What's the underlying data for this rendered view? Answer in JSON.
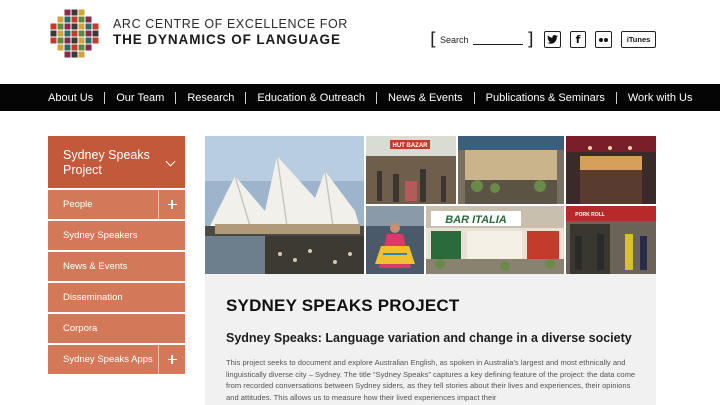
{
  "header": {
    "logo_line1": "ARC CENTRE OF EXCELLENCE FOR",
    "logo_line2": "THE DYNAMICS OF LANGUAGE",
    "search_label": "Search",
    "social": {
      "twitter": "t",
      "facebook": "f",
      "itunes": "iTunes"
    }
  },
  "nav": {
    "items": [
      "About Us",
      "Our Team",
      "Research",
      "Education & Outreach",
      "News & Events",
      "Publications & Seminars",
      "Work with Us"
    ]
  },
  "sidebar": {
    "title": "Sydney Speaks Project",
    "items": [
      {
        "label": "People",
        "expandable": true
      },
      {
        "label": "Sydney Speakers",
        "expandable": false
      },
      {
        "label": "News & Events",
        "expandable": false
      },
      {
        "label": "Dissemination",
        "expandable": false
      },
      {
        "label": "Corpora",
        "expandable": false
      },
      {
        "label": "Sydney Speaks Apps",
        "expandable": true
      }
    ]
  },
  "collage": {
    "signs": {
      "bazaar": "HUT BAZAR",
      "bar": "BAR ITALIA",
      "pork": "PORK ROLL"
    }
  },
  "content": {
    "title": "SYDNEY SPEAKS PROJECT",
    "subtitle": "Sydney Speaks: Language variation and change in a diverse society",
    "body": "This project seeks to document and explore Australian English, as spoken in Australia's largest and most ethnically and linguistically diverse city – Sydney. The title “Sydney Speaks” captures a key defining feature of the project: the data come from recorded conversations between Sydney siders, as they tell stories about their lives and experiences, their opinions and attitudes. This allows us to measure how their lived experiences impact their"
  },
  "colors": {
    "nav_bg": "#050505",
    "sidebar_head": "#c2593a",
    "sidebar_item": "#d4785a",
    "content_bg": "#f1f1f1"
  }
}
